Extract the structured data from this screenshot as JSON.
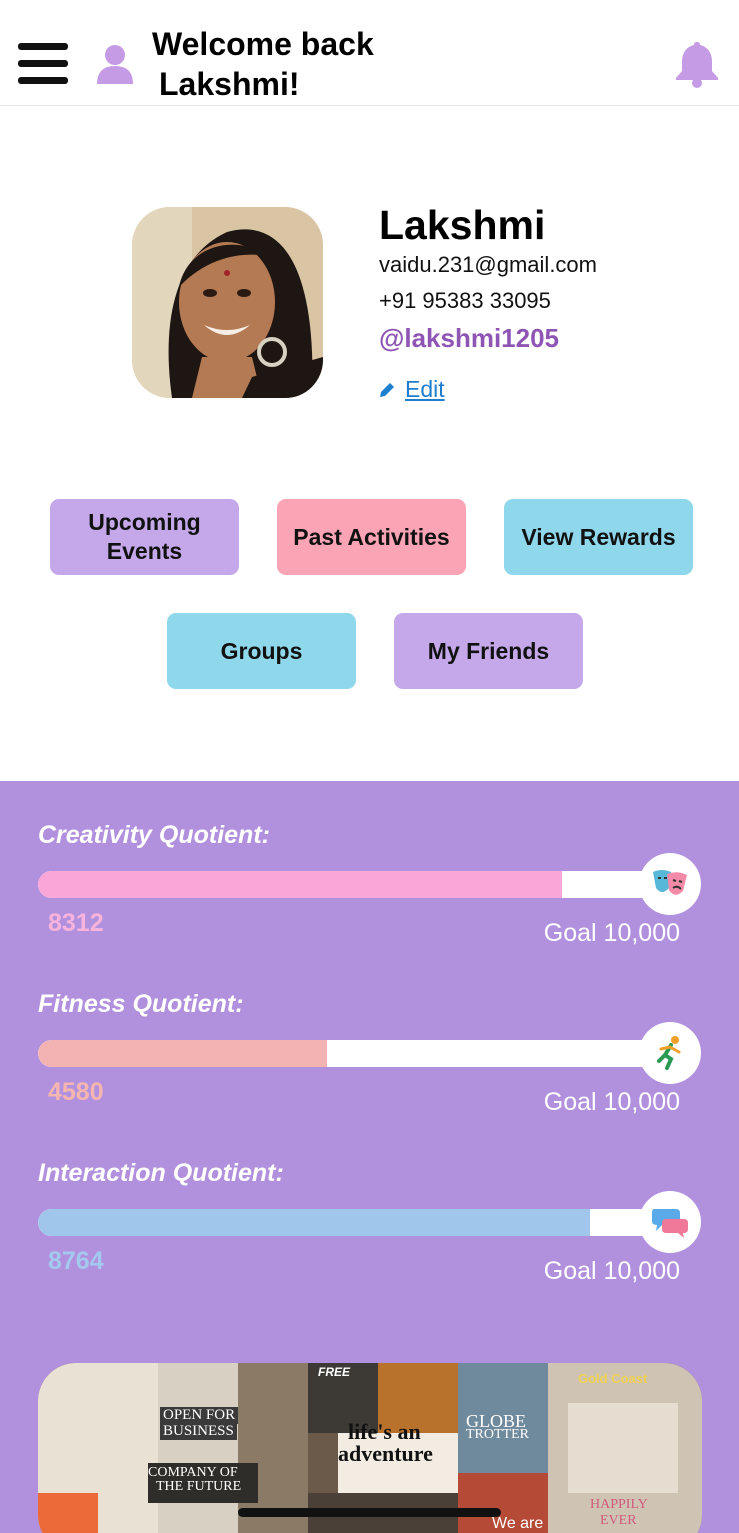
{
  "header": {
    "welcome_line1": "Welcome back",
    "welcome_line2": "Lakshmi!"
  },
  "profile": {
    "name": "Lakshmi",
    "email": "vaidu.231@gmail.com",
    "phone": "+91 95383 33095",
    "handle": "@lakshmi1205",
    "edit_label": "Edit"
  },
  "actions": {
    "upcoming_events": "Upcoming Events",
    "past_activities": "Past Activities",
    "view_rewards": "View Rewards",
    "groups": "Groups",
    "my_friends": "My Friends"
  },
  "quotients": [
    {
      "title": "Creativity Quotient:",
      "value": "8312",
      "goal": "Goal 10,000",
      "progress": 0.8312,
      "color": "#fba6d8",
      "value_color": "#f8b3dc",
      "icon": "theater-masks-icon"
    },
    {
      "title": "Fitness Quotient:",
      "value": "4580",
      "goal": "Goal 10,000",
      "progress": 0.458,
      "color": "#f4b3b3",
      "value_color": "#f5b6b1",
      "icon": "running-person-icon"
    },
    {
      "title": "Interaction Quotient:",
      "value": "8764",
      "goal": "Goal 10,000",
      "progress": 0.8764,
      "color": "#a1c6ec",
      "value_color": "#a4c9ee",
      "icon": "speech-bubbles-icon"
    }
  ],
  "vision_board": {
    "texts": [
      "life's an",
      "adventure",
      "GLOBE",
      "TROTTER",
      "OPEN FOR",
      "BUSINESS",
      "COMPANY OF",
      "THE FUTURE",
      "Gold Coast",
      "HAPPILY",
      "EVER",
      "We are",
      "FREE"
    ]
  },
  "colors": {
    "panel": "#b191dd",
    "accent_purple": "#8e55b5",
    "link_blue": "#1f7fcf",
    "icon_lilac": "#c59be6"
  }
}
